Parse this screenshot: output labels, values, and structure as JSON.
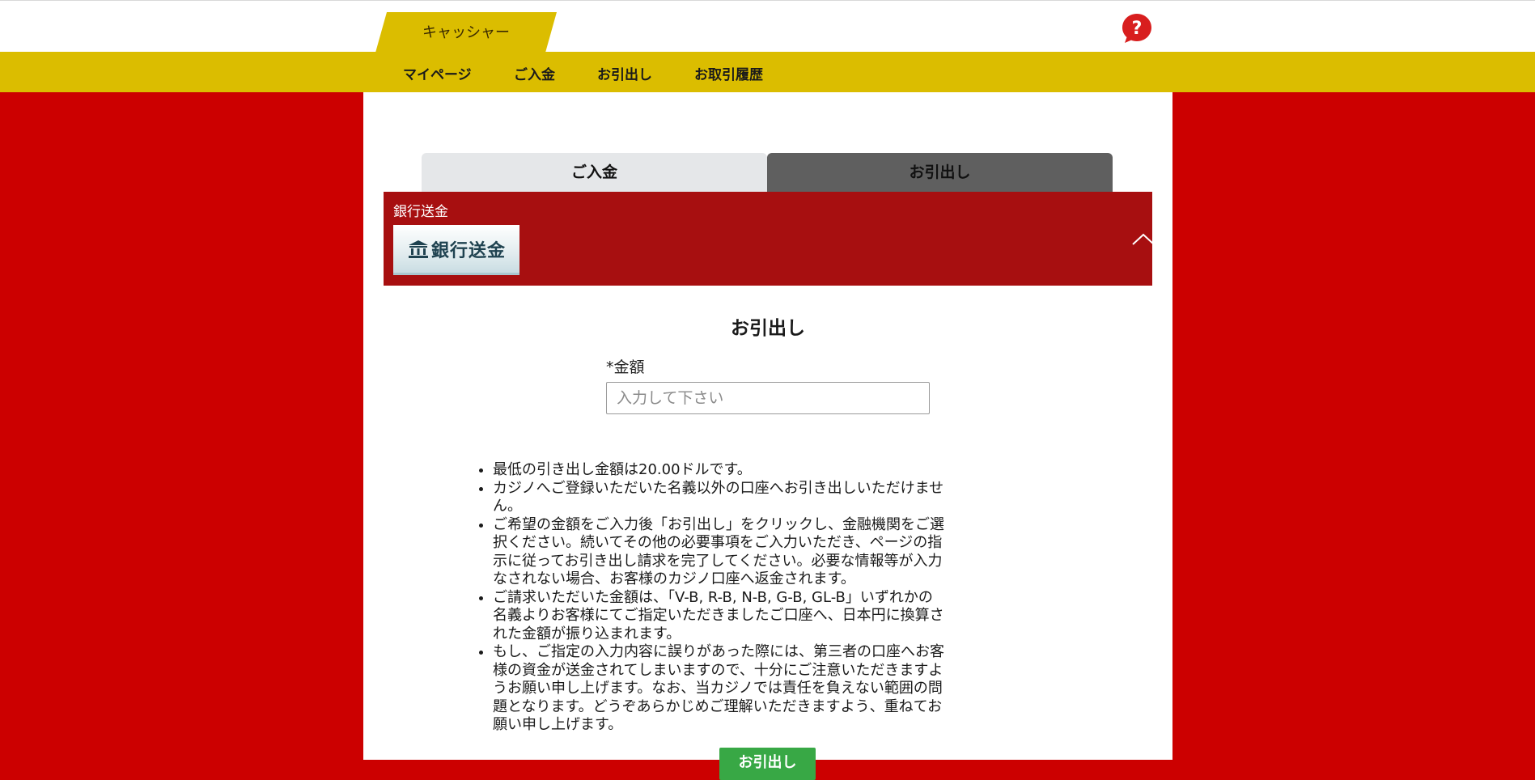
{
  "header": {
    "cashier_tab": "キャッシャー",
    "help_icon": "help-question-icon"
  },
  "nav": {
    "items": [
      {
        "label": "マイページ"
      },
      {
        "label": "ご入金"
      },
      {
        "label": "お引出し"
      },
      {
        "label": "お取引履歴"
      }
    ]
  },
  "tabs": {
    "deposit": "ご入金",
    "withdraw": "お引出し",
    "active": "withdraw"
  },
  "method": {
    "label": "銀行送金",
    "logo_text": "銀行送金",
    "logo_icon": "bank-building-icon",
    "collapse_icon": "chevron-up-icon"
  },
  "form": {
    "title": "お引出し",
    "amount_label": "*金額",
    "amount_placeholder": "入力して下さい",
    "amount_value": "",
    "submit_label": "お引出し"
  },
  "notes": [
    "最低の引き出し金額は20.00ドルです。",
    "カジノへご登録いただいた名義以外の口座へお引き出しいただけません。",
    "ご希望の金額をご入力後「お引出し」をクリックし、金融機関をご選択ください。続いてその他の必要事項をご入力いただき、ページの指示に従ってお引き出し請求を完了してください。必要な情報等が入力なされない場合、お客様のカジノ口座へ返金されます。",
    "ご請求いただいた金額は、「V-B, R-B, N-B, G-B, GL-B」いずれかの名義よりお客様にてご指定いただきましたご口座へ、日本円に換算された金額が振り込まれます。",
    "もし、ご指定の入力内容に誤りがあった際には、第三者の口座へお客様の資金が送金されてしまいますので、十分にご注意いただきますようお願い申し上げます。なお、当カジノでは責任を負えない範囲の問題となります。どうぞあらかじめご理解いただきますよう、重ねてお願い申し上げます。"
  ],
  "colors": {
    "background": "#cc0000",
    "brand_yellow": "#dbbd00",
    "method_header": "#a70f10",
    "active_tab": "#5f5f5f",
    "inactive_tab": "#e5e7e9",
    "submit": "#38a845"
  }
}
